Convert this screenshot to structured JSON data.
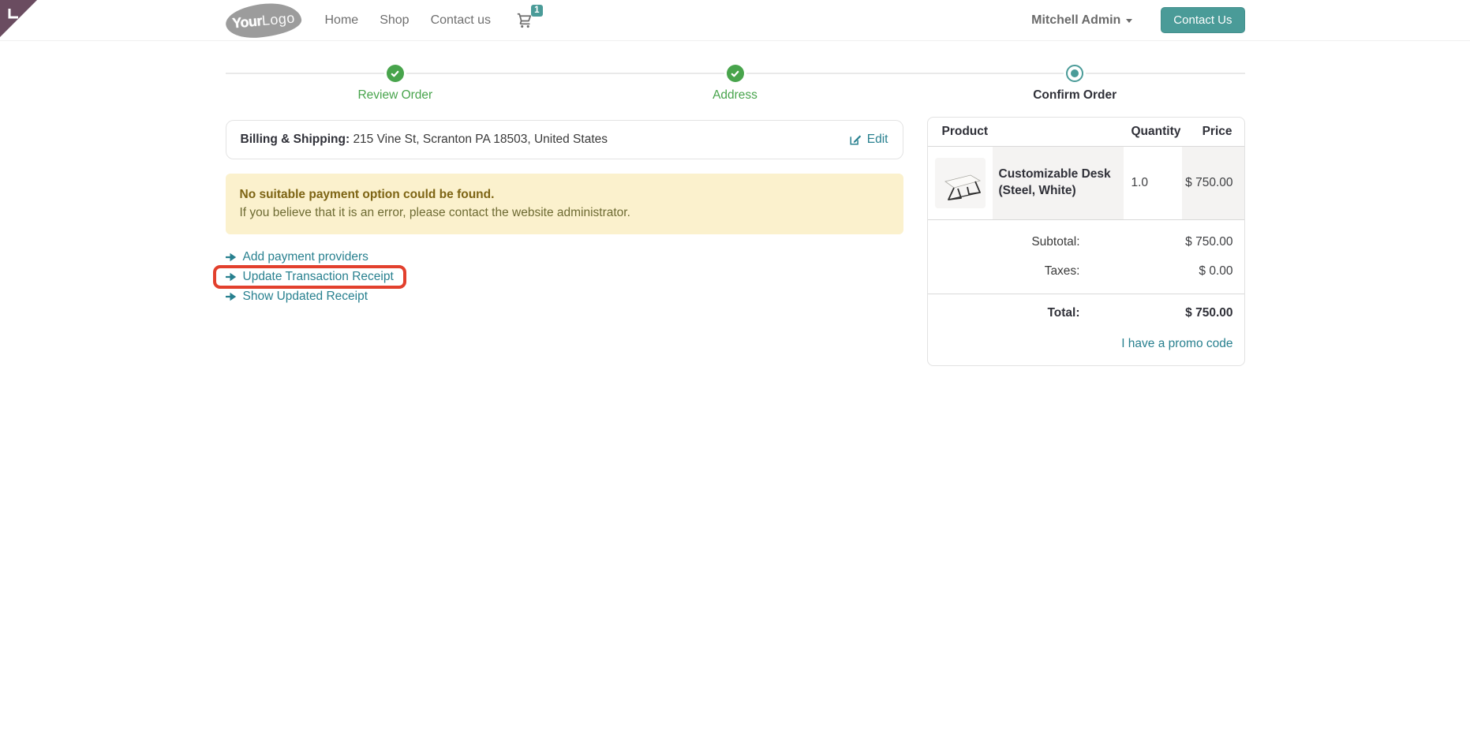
{
  "navbar": {
    "logo": {
      "part1": "Your",
      "part2": "Logo"
    },
    "links": [
      {
        "label": "Home"
      },
      {
        "label": "Shop"
      },
      {
        "label": "Contact us"
      }
    ],
    "cart_count": "1",
    "user_menu_label": "Mitchell Admin",
    "contact_button_label": "Contact Us"
  },
  "steps": [
    {
      "label": "Review Order",
      "state": "done"
    },
    {
      "label": "Address",
      "state": "done"
    },
    {
      "label": "Confirm Order",
      "state": "active"
    }
  ],
  "billing": {
    "label": "Billing & Shipping:",
    "address": "215 Vine St, Scranton PA 18503, United States",
    "edit_label": "Edit"
  },
  "alert": {
    "title": "No suitable payment option could be found.",
    "body": "If you believe that it is an error, please contact the website administrator."
  },
  "actions": [
    {
      "label": "Add payment providers",
      "highlighted": false
    },
    {
      "label": "Update Transaction Receipt",
      "highlighted": true
    },
    {
      "label": "Show Updated Receipt",
      "highlighted": false
    }
  ],
  "order": {
    "headers": {
      "product": "Product",
      "quantity": "Quantity",
      "price": "Price"
    },
    "items": [
      {
        "name": "Customizable Desk (Steel, White)",
        "quantity": "1.0",
        "price": "$ 750.00"
      }
    ],
    "totals": {
      "subtotal_label": "Subtotal:",
      "subtotal_value": "$ 750.00",
      "taxes_label": "Taxes:",
      "taxes_value": "$ 0.00",
      "total_label": "Total:",
      "total_value": "$ 750.00"
    },
    "promo_label": "I have a promo code"
  },
  "colors": {
    "accent_teal": "#4a9b98",
    "link_teal": "#28808f",
    "success_green": "#48a44c",
    "warning_bg": "#fbf1cd",
    "warning_title_text": "#7d6414",
    "warning_body_text": "#6e6b33",
    "highlight_red": "#e2402d",
    "ribbon_plum": "#6a4c60",
    "logo_gray": "#9c9c9c"
  }
}
